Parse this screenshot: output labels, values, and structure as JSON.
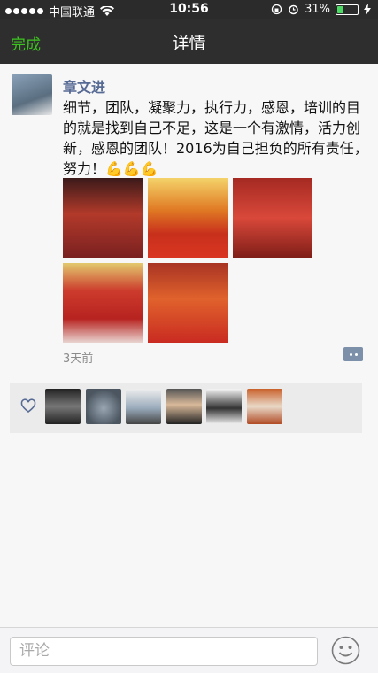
{
  "status": {
    "carrier": "中国联通",
    "time": "10:56",
    "battery": "31%",
    "battery_fraction": 0.31
  },
  "nav": {
    "back_label": "完成",
    "title": "详情"
  },
  "post": {
    "author": "章文进",
    "text": "细节，团队，凝聚力，执行力，感恩，培训的目的就是找到自己不足，这是一个有激情，活力创新，感恩的团队！2016为自己担负的所有责任，努力！💪💪💪",
    "time": "3天前",
    "photo_count": 5
  },
  "likes": {
    "count": 6
  },
  "comment": {
    "placeholder": "评论"
  },
  "colors": {
    "accent": "#3cc51f",
    "link": "#576b95"
  }
}
